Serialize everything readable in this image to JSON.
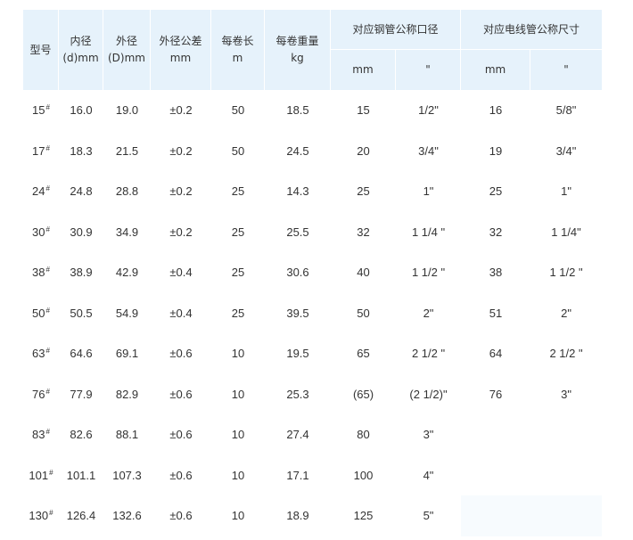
{
  "headers": {
    "model": "型号",
    "inner_dia": [
      "内径",
      "(d)mm"
    ],
    "outer_dia": [
      "外径",
      "(D)mm"
    ],
    "outer_tol": [
      "外径公差",
      "mm"
    ],
    "roll_length": [
      "每卷长",
      "m"
    ],
    "roll_weight": [
      "每卷重量",
      "kg"
    ],
    "steel_pipe_group": "对应钢管公称口径",
    "conduit_group": "对应电线管公称尺寸",
    "unit_mm": "mm",
    "unit_inch": "\""
  },
  "rows": [
    {
      "model": "15",
      "mark": "#",
      "d": "16.0",
      "D": "19.0",
      "tol": "±0.2",
      "len": "50",
      "wt": "18.5",
      "sp_mm": "15",
      "sp_in": "1/2\"",
      "cd_mm": "16",
      "cd_in": "5/8\""
    },
    {
      "model": "17",
      "mark": "#",
      "d": "18.3",
      "D": "21.5",
      "tol": "±0.2",
      "len": "50",
      "wt": "24.5",
      "sp_mm": "20",
      "sp_in": "3/4\"",
      "cd_mm": "19",
      "cd_in": "3/4\""
    },
    {
      "model": "24",
      "mark": "#",
      "d": "24.8",
      "D": "28.8",
      "tol": "±0.2",
      "len": "25",
      "wt": "14.3",
      "sp_mm": "25",
      "sp_in": "1\"",
      "cd_mm": "25",
      "cd_in": "1\""
    },
    {
      "model": "30",
      "mark": "#",
      "d": "30.9",
      "D": "34.9",
      "tol": "±0.2",
      "len": "25",
      "wt": "25.5",
      "sp_mm": "32",
      "sp_in": "1 1/4 \"",
      "cd_mm": "32",
      "cd_in": "1 1/4\""
    },
    {
      "model": "38",
      "mark": "#",
      "d": "38.9",
      "D": "42.9",
      "tol": "±0.4",
      "len": "25",
      "wt": "30.6",
      "sp_mm": "40",
      "sp_in": "1 1/2 \"",
      "cd_mm": "38",
      "cd_in": "1 1/2 \""
    },
    {
      "model": "50",
      "mark": "#",
      "d": "50.5",
      "D": "54.9",
      "tol": "±0.4",
      "len": "25",
      "wt": "39.5",
      "sp_mm": "50",
      "sp_in": "2\"",
      "cd_mm": "51",
      "cd_in": "2\""
    },
    {
      "model": "63",
      "mark": "#",
      "d": "64.6",
      "D": "69.1",
      "tol": "±0.6",
      "len": "10",
      "wt": "19.5",
      "sp_mm": "65",
      "sp_in": "2 1/2 \"",
      "cd_mm": "64",
      "cd_in": "2 1/2 \""
    },
    {
      "model": "76",
      "mark": "#",
      "d": "77.9",
      "D": "82.9",
      "tol": "±0.6",
      "len": "10",
      "wt": "25.3",
      "sp_mm": "(65)",
      "sp_in": "(2 1/2)\"",
      "cd_mm": "76",
      "cd_in": "3\""
    },
    {
      "model": "83",
      "mark": "#",
      "d": "82.6",
      "D": "88.1",
      "tol": "±0.6",
      "len": "10",
      "wt": "27.4",
      "sp_mm": "80",
      "sp_in": "3\"",
      "cd_mm": "",
      "cd_in": ""
    },
    {
      "model": "101",
      "mark": "#",
      "d": "101.1",
      "D": "107.3",
      "tol": "±0.6",
      "len": "10",
      "wt": "17.1",
      "sp_mm": "100",
      "sp_in": "4\"",
      "cd_mm": "",
      "cd_in": ""
    },
    {
      "model": "130",
      "mark": "#",
      "d": "126.4",
      "D": "132.6",
      "tol": "±0.6",
      "len": "10",
      "wt": "18.9",
      "sp_mm": "125",
      "sp_in": "5\"",
      "cd_mm": "",
      "cd_in": ""
    }
  ],
  "colors": {
    "header_bg": "#e6f2fb",
    "text": "#333333",
    "blank_cell_bg": "#f7fbfe"
  }
}
